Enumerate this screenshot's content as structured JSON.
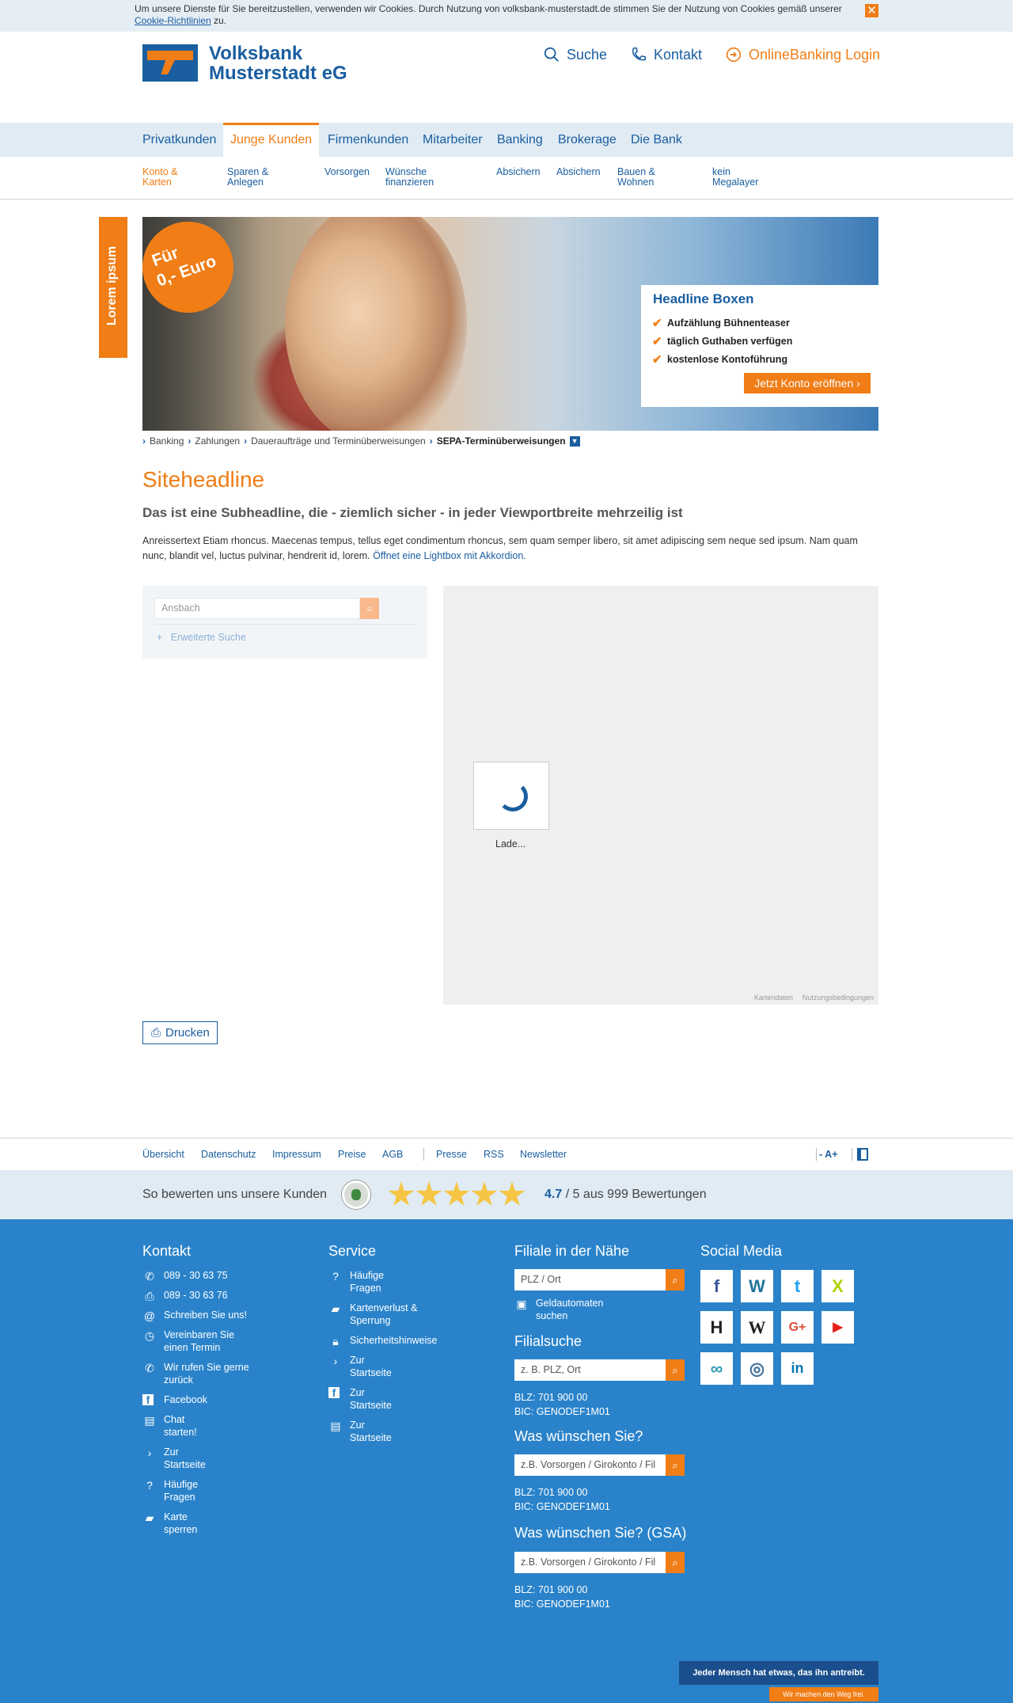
{
  "cookie": {
    "text": "Um unsere Dienste für Sie bereitzustellen, verwenden wir Cookies. Durch Nutzung von volksbank-musterstadt.de stimmen Sie der Nutzung von Cookies gemäß unserer",
    "link": "Cookie-Richtlinien",
    "suffix": " zu.",
    "close": "✕"
  },
  "header": {
    "bank_name_1": "Volksbank",
    "bank_name_2": "Musterstadt eG",
    "search": "Suche",
    "contact": "Kontakt",
    "login": "OnlineBanking Login"
  },
  "nav": {
    "main": [
      "Privatkunden",
      "Junge Kunden",
      "Firmenkunden",
      "Mitarbeiter",
      "Banking",
      "Brokerage",
      "Die Bank"
    ],
    "sub": [
      "Konto & Karten",
      "Sparen & Anlegen",
      "Vorsorgen",
      "Wünsche finanzieren",
      "Absichern",
      "Absichern",
      "Bauen & Wohnen",
      "kein Megalayer"
    ]
  },
  "sidetab": "Lorem ipsum",
  "hero": {
    "sticker_1": "Für",
    "sticker_2": "0,- Euro",
    "box_title": "Headline Boxen",
    "items": [
      "Aufzählung Bühnenteaser",
      "täglich Guthaben verfügen",
      "kostenlose Kontoführung"
    ],
    "cta": "Jetzt Konto eröffnen"
  },
  "breadcrumb": [
    "Banking",
    "Zahlungen",
    "Daueraufträge und Terminüberweisungen",
    "SEPA-Terminüberweisungen"
  ],
  "content": {
    "headline": "Siteheadline",
    "subheadline": "Das ist eine Subheadline, die - ziemlich sicher - in jeder Viewportbreite mehrzeilig ist",
    "teaser": "Anreissertext Etiam rhoncus. Maecenas tempus, tellus eget condimentum rhoncus, sem quam semper libero, sit amet adipiscing sem neque sed ipsum. Nam quam nunc, blandit vel, luctus pulvinar, hendrerit id, lorem. ",
    "teaser_link": "Öffnet eine Lightbox mit Akkordion."
  },
  "search_panel": {
    "placeholder": "Ansbach",
    "advanced": "Erweiterte Suche"
  },
  "map": {
    "loading": "Lade...",
    "footer_1": "Kartendaten",
    "footer_2": "Nutzungsbedingungen"
  },
  "print": "Drucken",
  "footer_links": [
    "Übersicht",
    "Datenschutz",
    "Impressum",
    "Preise",
    "AGB",
    "Presse",
    "RSS",
    "Newsletter"
  ],
  "font_size_ctrl": "- A+",
  "rating": {
    "label": "So bewerten uns unsere Kunden",
    "stars": 5,
    "score": "4.7",
    "rest": " / 5 aus 999 Bewertungen"
  },
  "footer": {
    "kontakt_title": "Kontakt",
    "kontakt": [
      {
        "icon": "phone-icon",
        "text": "089 - 30 63 75"
      },
      {
        "icon": "fax-icon",
        "text": "089 - 30 63 76"
      },
      {
        "icon": "at-icon",
        "text": "Schreiben Sie uns!"
      },
      {
        "icon": "clock-icon",
        "text": "Vereinbaren Sie einen Termin"
      },
      {
        "icon": "callback-icon",
        "text": "Wir rufen Sie gerne zurück"
      },
      {
        "icon": "facebook-icon",
        "text": "Facebook"
      },
      {
        "icon": "chat-icon",
        "text": "Chat starten!"
      },
      {
        "icon": "chevron-icon",
        "text": "Zur Startseite"
      },
      {
        "icon": "faq-icon",
        "text": "Häufige Fragen"
      },
      {
        "icon": "card-icon",
        "text": "Karte sperren"
      }
    ],
    "service_title": "Service",
    "service": [
      {
        "icon": "faq-icon",
        "text": "Häufige Fragen"
      },
      {
        "icon": "card-icon",
        "text": "Kartenverlust & Sperrung"
      },
      {
        "icon": "lock-icon",
        "text": "Sicherheitshinweise"
      },
      {
        "icon": "chevron-icon",
        "text": "Zur Startseite"
      },
      {
        "icon": "facebook-icon",
        "text": "Zur Startseite"
      },
      {
        "icon": "chat-icon",
        "text": "Zur Startseite"
      }
    ],
    "filiale_title": "Filiale in der Nähe",
    "filiale_placeholder": "PLZ / Ort",
    "atm": "Geldautomaten suchen",
    "filialsuche_title": "Filialsuche",
    "filialsuche_placeholder": "z. B. PLZ, Ort",
    "blz": "BLZ: 701 900 00",
    "bic": "BIC: GENODEF1M01",
    "wish_title": "Was wünschen Sie?",
    "wish_placeholder": "z.B. Vorsorgen / Girokonto / Fil",
    "wish_title_gsa": "Was wünschen Sie? (GSA)",
    "social_title": "Social Media",
    "social": [
      "f",
      "W",
      "t",
      "X",
      "H",
      "W",
      "G+",
      "▶",
      "∞",
      "◎",
      "in"
    ],
    "claim": "Jeder Mensch hat etwas, das ihn antreibt.",
    "claim_sub": "Wir machen den Weg frei."
  },
  "colors": {
    "brand_blue": "#1a5ea0",
    "brand_orange": "#f07d16",
    "footer_blue": "#2a83ca"
  }
}
